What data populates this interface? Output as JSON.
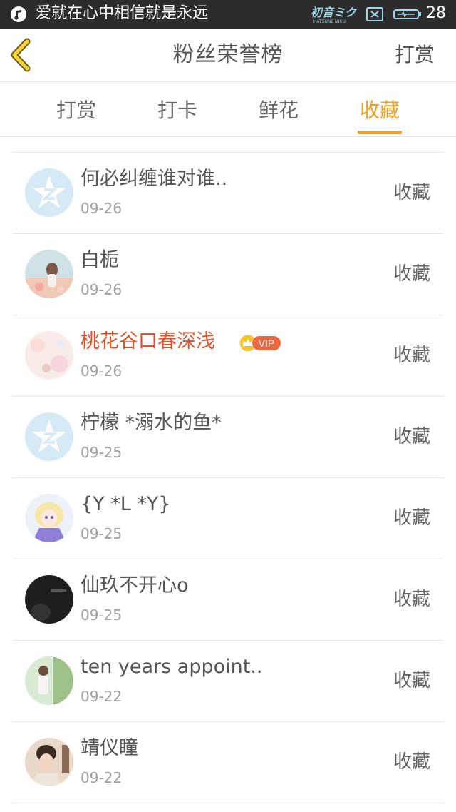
{
  "status_bar": {
    "song": "爱就在心中相信就是永远",
    "battery": "28",
    "icons": [
      "music-icon",
      "miku-logo",
      "mail-icon",
      "battery-icon"
    ]
  },
  "header": {
    "title": "粉丝荣誉榜",
    "action": "打赏",
    "back_icon": "chevron-left-icon"
  },
  "tabs": [
    {
      "label": "打赏",
      "active": false
    },
    {
      "label": "打卡",
      "active": false
    },
    {
      "label": "鲜花",
      "active": false
    },
    {
      "label": "收藏",
      "active": true
    }
  ],
  "colors": {
    "accent": "#f0a020",
    "vip_name": "#e0522c",
    "vip_badge": "#e86a45",
    "status_bar": "#2c2c2c"
  },
  "fans": [
    {
      "name": "何必纠缠谁对谁..",
      "date": "09-26",
      "action": "收藏",
      "avatar": "qzone-default-avatar",
      "vip": false
    },
    {
      "name": "白栀",
      "date": "09-26",
      "action": "收藏",
      "avatar": "girl-photo-avatar",
      "vip": false
    },
    {
      "name": "桃花谷口春深浅",
      "date": "09-26",
      "action": "收藏",
      "avatar": "pastel-flower-avatar",
      "vip": true,
      "vip_label": "VIP"
    },
    {
      "name": "柠檬 *溺水的鱼*",
      "date": "09-25",
      "action": "收藏",
      "avatar": "qzone-default-avatar",
      "vip": false
    },
    {
      "name": "{Y *L *Y}",
      "date": "09-25",
      "action": "收藏",
      "avatar": "anime-girl-avatar",
      "vip": false
    },
    {
      "name": "仙玖不开心o",
      "date": "09-25",
      "action": "收藏",
      "avatar": "dark-photo-avatar",
      "vip": false
    },
    {
      "name": "ten years appoint..",
      "date": "09-22",
      "action": "收藏",
      "avatar": "outdoor-photo-avatar",
      "vip": false
    },
    {
      "name": "靖仪瞳",
      "date": "09-22",
      "action": "收藏",
      "avatar": "portrait-photo-avatar",
      "vip": false
    }
  ]
}
